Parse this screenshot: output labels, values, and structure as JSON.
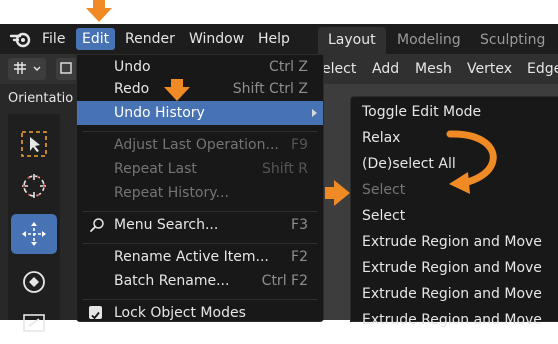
{
  "menubar": {
    "items": [
      {
        "label": "File"
      },
      {
        "label": "Edit"
      },
      {
        "label": "Render"
      },
      {
        "label": "Window"
      },
      {
        "label": "Help"
      }
    ],
    "workspace_tabs": [
      {
        "label": "Layout"
      },
      {
        "label": "Modeling"
      },
      {
        "label": "Sculpting"
      }
    ]
  },
  "header": {
    "items": [
      {
        "label": "elect"
      },
      {
        "label": "Add"
      },
      {
        "label": "Mesh"
      },
      {
        "label": "Vertex"
      },
      {
        "label": "Edge"
      }
    ]
  },
  "toolbar": {
    "orientation_label": "Orientatio"
  },
  "edit_menu": {
    "items": [
      {
        "label": "Undo",
        "shortcut": "Ctrl Z"
      },
      {
        "label": "Redo",
        "shortcut": "Shift Ctrl Z"
      },
      {
        "label": "Undo History",
        "shortcut": ""
      },
      {
        "label": "Adjust Last Operation...",
        "shortcut": "F9"
      },
      {
        "label": "Repeat Last",
        "shortcut": "Shift R"
      },
      {
        "label": "Repeat History...",
        "shortcut": ""
      },
      {
        "label": "Menu Search...",
        "shortcut": "F3"
      },
      {
        "label": "Rename Active Item...",
        "shortcut": "F2"
      },
      {
        "label": "Batch Rename...",
        "shortcut": "Ctrl F2"
      },
      {
        "label": "Lock Object Modes",
        "shortcut": ""
      }
    ]
  },
  "undo_history": {
    "items": [
      {
        "label": "Toggle Edit Mode"
      },
      {
        "label": "Relax"
      },
      {
        "label": "(De)select All"
      },
      {
        "label": "Select"
      },
      {
        "label": "Select"
      },
      {
        "label": "Extrude Region and Move"
      },
      {
        "label": "Extrude Region and Move"
      },
      {
        "label": "Extrude Region and Move"
      },
      {
        "label": "Extrude Region and Move"
      }
    ]
  },
  "colors": {
    "accent": "#4772b3",
    "annotation_arrow": "#f08a24",
    "menu_bg": "#181818"
  }
}
